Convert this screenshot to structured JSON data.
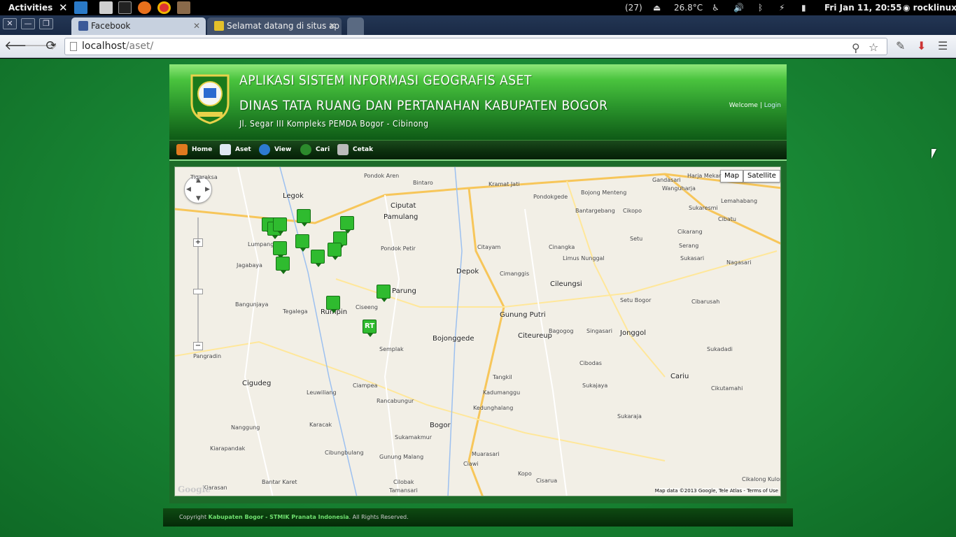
{
  "topbar": {
    "activities": "Activities",
    "notifications": "(27)",
    "temperature": "26.8°C",
    "datetime": "Fri Jan 11, 20:55",
    "user": "rocklinux"
  },
  "browser": {
    "tabs": [
      {
        "title": "Facebook"
      },
      {
        "title": "Selamat datang di situs ap"
      }
    ],
    "url_host": "localhost",
    "url_path": "/aset/"
  },
  "header": {
    "title_line1": "APLIKASI SISTEM INFORMASI GEOGRAFIS ASET",
    "title_line2": "DINAS TATA RUANG DAN PERTANAHAN KABUPATEN BOGOR",
    "address": "Jl. Segar III Kompleks PEMDA Bogor - Cibinong",
    "welcome": "Welcome",
    "login": "Login"
  },
  "menu": {
    "items": [
      "Home",
      "Aset",
      "View",
      "Cari",
      "Cetak"
    ]
  },
  "map": {
    "toggle_map": "Map",
    "toggle_satellite": "Satellite",
    "copyright": "Map data ©2013 Google, Tele Atlas - Terms of Use",
    "google": "Google",
    "labels": [
      "Tigaraksa",
      "Legok",
      "Pondok Aren",
      "Bintaro",
      "Ciputat",
      "Pamulang",
      "Kramat Jati",
      "Pondokgede",
      "Bojong Menteng",
      "Bantargebang",
      "Gandasari",
      "Wanguharja",
      "Harja Mekar",
      "Lemahabang",
      "Sukaresmi",
      "Cibatu",
      "Cikarang",
      "Depok",
      "Cileungsi",
      "Setu",
      "Serang",
      "Sukasari",
      "Nagasari",
      "Parung",
      "Cinangka",
      "Pondok Petir",
      "Citayam",
      "Cimanggis",
      "Limus Nunggal",
      "Rumpin",
      "Ciseeng",
      "Gunung Putri",
      "Jonggol",
      "Citeureup",
      "Bojonggede",
      "Semplak",
      "Cigudeg",
      "Ciampea",
      "Leuwiliang",
      "Bogor",
      "Kedunghalang",
      "Sukajaya",
      "Cariu",
      "Cikutamahi",
      "Nanggung",
      "Cibungbulang",
      "Ciawi",
      "Cisarua",
      "Kopo",
      "Sukamakmur",
      "Cikalong Kulon",
      "Jagabaya",
      "Bangunjaya",
      "Tegalega",
      "Pangradin",
      "Cikopo",
      "Lumpang",
      "Setu Bogor",
      "Singasari",
      "Bagogog",
      "Cibodas",
      "Rancabungur",
      "Karacak",
      "Gunung Malang",
      "Tamansari",
      "Cilobak",
      "Bantar Karet",
      "Kiarapandak",
      "Kiarasan",
      "Sukadadi",
      "Cibarusah",
      "Kadumanggu",
      "Tangkil",
      "Muarasari",
      "Sukaraja"
    ],
    "markers": [
      "RT"
    ]
  },
  "footer": {
    "prefix": "Copyright",
    "brand": "Kabupaten Bogor - STMIK Pranata Indonesia",
    "suffix": ". All Rights Reserved."
  },
  "colors": {
    "header_green": "#2b962c",
    "menu_dark": "#0b2e0d",
    "marker_green": "#2fbb2f"
  }
}
